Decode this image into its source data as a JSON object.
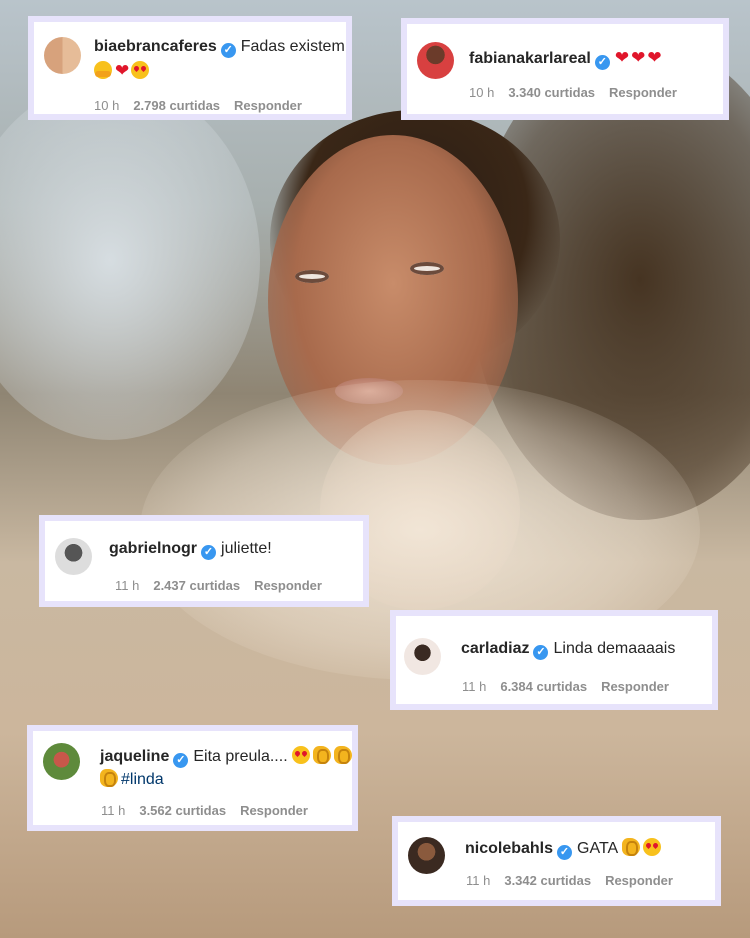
{
  "comments": [
    {
      "user": "biaebrancaferes",
      "text": "Fadas existem",
      "text2": "",
      "time": "10 h",
      "likes": "2.798 curtidas",
      "reply": "Responder",
      "avatar": "avatar-duo-photo"
    },
    {
      "user": "fabianakarlareal",
      "text": "",
      "time": "10 h",
      "likes": "3.340 curtidas",
      "reply": "Responder",
      "avatar": "avatar-red-dress-photo"
    },
    {
      "user": "gabrielnogr",
      "text": "juliette!",
      "time": "11 h",
      "likes": "2.437 curtidas",
      "reply": "Responder",
      "avatar": "avatar-bw-photo"
    },
    {
      "user": "carladiaz",
      "text": "Linda demaaaais",
      "time": "11 h",
      "likes": "6.384 curtidas",
      "reply": "Responder",
      "avatar": "avatar-sunglasses-photo"
    },
    {
      "user": "jaqueline",
      "text": "Eita preula....",
      "hashtag": "#linda",
      "time": "11 h",
      "likes": "3.562 curtidas",
      "reply": "Responder",
      "avatar": "avatar-outdoor-photo"
    },
    {
      "user": "nicolebahls",
      "text": "GATA",
      "time": "11 h",
      "likes": "3.342 curtidas",
      "reply": "Responder",
      "avatar": "avatar-portrait-photo"
    }
  ],
  "colors": {
    "card_border": "#e7e3fb",
    "verified": "#3897f0",
    "heart": "#e0162b",
    "meta": "#8e8e8e"
  },
  "icons": [
    "verified-badge-icon",
    "red-heart-emoji",
    "heart-eyes-emoji",
    "hugging-emoji",
    "clapping-hands-emoji"
  ]
}
